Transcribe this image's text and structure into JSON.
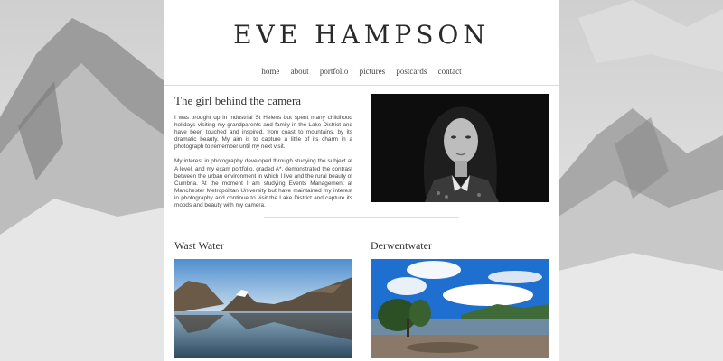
{
  "site": {
    "title": "EVE HAMPSON"
  },
  "nav": {
    "items": [
      "home",
      "about",
      "portfolio",
      "pictures",
      "postcards",
      "contact"
    ]
  },
  "about": {
    "heading": "The girl behind the camera",
    "paragraphs": [
      "I was brought up in industrial St Helens but spent many childhood holidays visiting my grandparents and family in the Lake District and have been touched and inspired, from coast to mountains, by its dramatic beauty. My aim is to capture a little of its charm in a photograph to remember until my next visit.",
      "My interest in photography developed through studying the subject at A level, and my exam portfolio, graded A*, demonstrated the contrast between the urban environment in which I live and the rural beauty of Cumbria. At the moment I am studying Events Management at Manchester Metropolitan University but have maintained my interest in photography and continue to visit the Lake District and capture its moods and beauty with my camera."
    ]
  },
  "gallery": [
    {
      "title": "Wast Water"
    },
    {
      "title": "Derwentwater"
    }
  ],
  "colors": {
    "page_bg": "#ffffff",
    "text": "#333333",
    "rule": "#dcdcdc"
  }
}
